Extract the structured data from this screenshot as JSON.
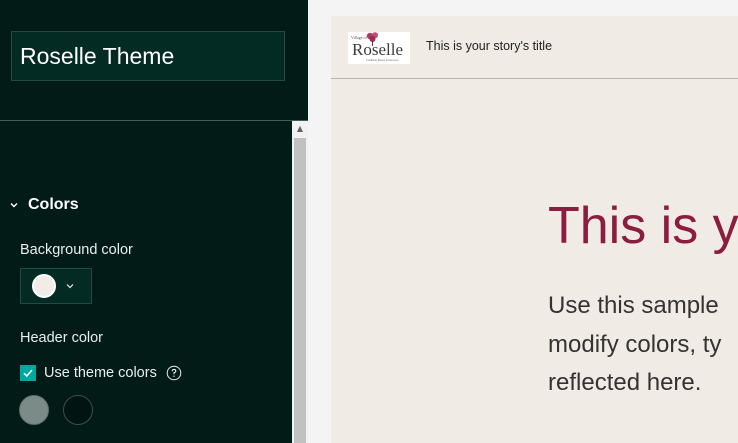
{
  "theme_editor": {
    "theme_name": "Roselle Theme",
    "colors_section": {
      "label": "Colors",
      "background_color_label": "Background color",
      "background_color": "#f3ece6",
      "header_color_label": "Header color",
      "use_theme_colors_label": "Use theme colors",
      "use_theme_colors_checked": true,
      "header_color_options": [
        "#7b8b88",
        "#021412"
      ]
    }
  },
  "preview": {
    "logo": {
      "small_text": "Village of",
      "word": "Roselle",
      "tagline": "Tradition Meets Tomorrow"
    },
    "story_title": "This is your story's title",
    "hero_title": "This is y",
    "hero_body_lines": [
      "Use this sample",
      "modify colors, ty",
      "reflected here."
    ]
  },
  "colors": {
    "panel_background": "#021b17",
    "accent": "#00a99d",
    "hero_title_color": "#8b1d40",
    "preview_background": "#f1ebe5"
  }
}
